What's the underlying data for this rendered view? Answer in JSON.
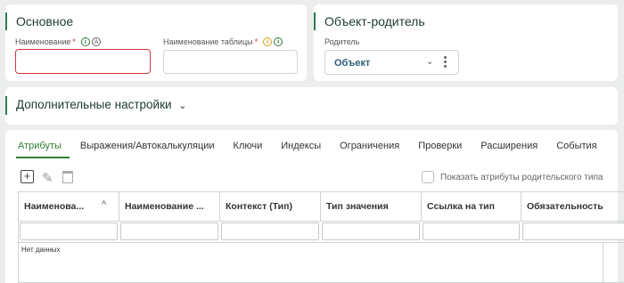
{
  "basic": {
    "title": "Основное",
    "name_label": "Наименование",
    "name_value": "",
    "table_label": "Наименование таблицы",
    "table_value": ""
  },
  "parent": {
    "title": "Объект-родитель",
    "label": "Родитель",
    "value": "Объект"
  },
  "extra": {
    "title": "Дополнительные настройки"
  },
  "tabs": [
    "Атрибуты",
    "Выражения/Автокалькуляции",
    "Ключи",
    "Индексы",
    "Ограничения",
    "Проверки",
    "Расширения",
    "События"
  ],
  "show_parent_attrs_label": "Показать атрибуты родительского типа",
  "columns": [
    "Наименова...",
    "Наименование ...",
    "Контекст (Тип)",
    "Тип значения",
    "Ссылка на тип",
    "Обязательность"
  ],
  "no_data": "Нет данных",
  "colors": {
    "accent": "#2e7d32",
    "error": "#d9363e",
    "link": "#2c5d77"
  }
}
